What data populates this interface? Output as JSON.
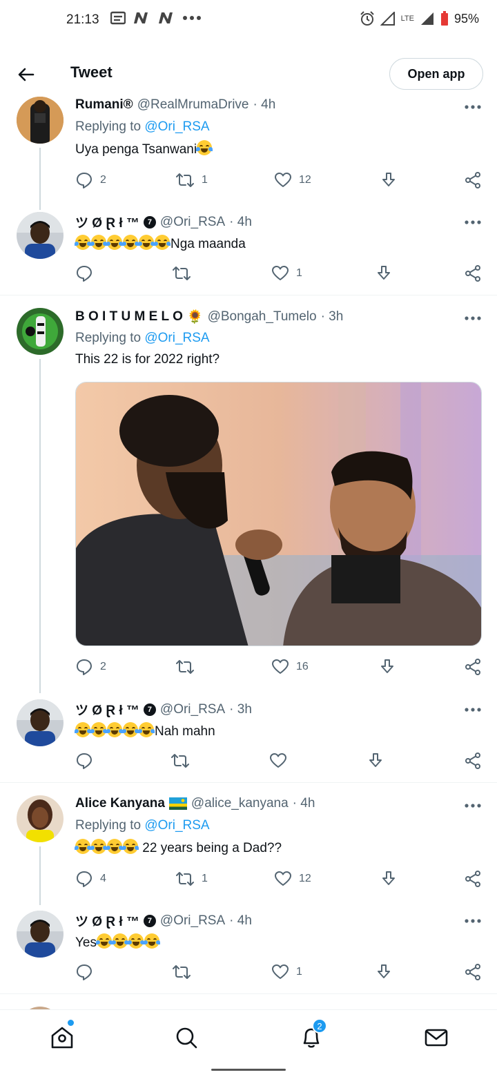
{
  "status_bar": {
    "time": "21:13",
    "network": "LTE",
    "battery": "95%"
  },
  "header": {
    "title": "Tweet",
    "open_app_label": "Open app"
  },
  "tweets": [
    {
      "name": "Rumani®",
      "handle": "@RealMrumaDrive",
      "time": "· 4h",
      "replying_prefix": "Replying to",
      "replying_to": "@Ori_RSA",
      "text": "Uya penga Tsanwani",
      "reply_count": "2",
      "retweet_count": "1",
      "like_count": "12"
    },
    {
      "name": "ツ Ø Ɽ ł ™",
      "badge": "7",
      "handle": "@Ori_RSA",
      "time": "· 4h",
      "text": "Nga maanda",
      "reply_count": "",
      "retweet_count": "",
      "like_count": "1"
    },
    {
      "name": "B O I T U M E L O",
      "name_emoji": "🌻",
      "handle": "@Bongah_Tumelo",
      "time": "· 3h",
      "replying_prefix": "Replying to",
      "replying_to": "@Ori_RSA",
      "text": "This 22 is for 2022 right?",
      "reply_count": "2",
      "retweet_count": "",
      "like_count": "16"
    },
    {
      "name": "ツ Ø Ɽ ł ™",
      "badge": "7",
      "handle": "@Ori_RSA",
      "time": "· 3h",
      "text": "Nah mahn",
      "reply_count": "",
      "retweet_count": "",
      "like_count": ""
    },
    {
      "name": "Alice Kanyana",
      "handle": "@alice_kanyana",
      "time": "· 4h",
      "replying_prefix": "Replying to",
      "replying_to": "@Ori_RSA",
      "text": " 22 years being a Dad??",
      "reply_count": "4",
      "retweet_count": "1",
      "like_count": "12"
    },
    {
      "name": "ツ Ø Ɽ ł ™",
      "badge": "7",
      "handle": "@Ori_RSA",
      "time": "· 4h",
      "text": "Yes",
      "reply_count": "",
      "retweet_count": "",
      "like_count": "1"
    }
  ],
  "bottom_nav": {
    "notifications_badge": "2"
  },
  "colors": {
    "accent": "#1d9bf0",
    "text_primary": "#0f1419",
    "text_secondary": "#536471",
    "divider": "#eff3f4"
  }
}
